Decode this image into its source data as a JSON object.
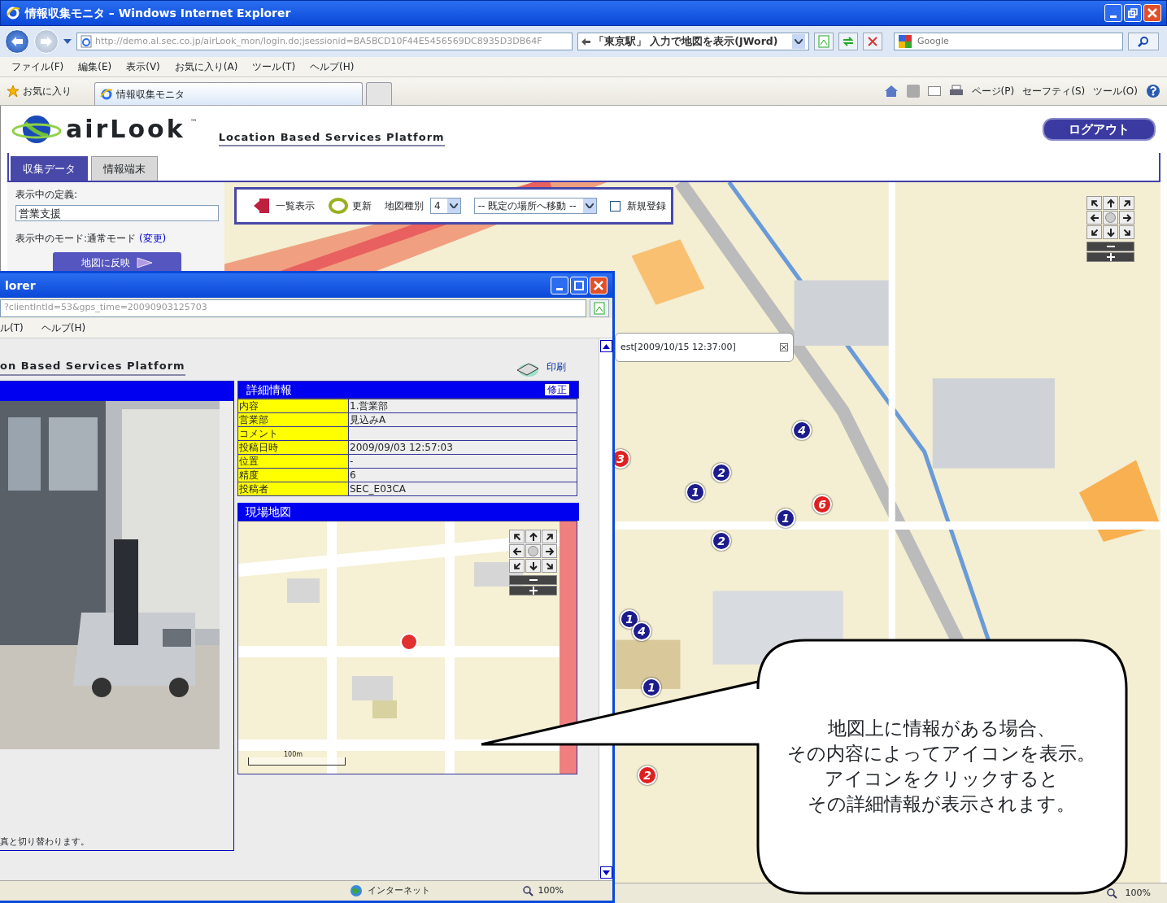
{
  "window": {
    "title": "情報収集モニタ – Windows Internet Explorer"
  },
  "address_bar": {
    "url": "http://demo.al.sec.co.jp/airLook_mon/login.do;jsessionid=BA5BCD10F44E5456569DC8935D3DB64F",
    "jword": "「東京駅」 入力で地図を表示(JWord)"
  },
  "search": {
    "placeholder": "Google"
  },
  "menu": [
    "ファイル(F)",
    "編集(E)",
    "表示(V)",
    "お気に入り(A)",
    "ツール(T)",
    "ヘルプ(H)"
  ],
  "favorites": "お気に入り",
  "tabs": [
    {
      "label": "情報収集モニタ",
      "selected": true
    }
  ],
  "command_bar": [
    "ページ(P)",
    "セーフティ(S)",
    "ツール(O)"
  ],
  "app": {
    "logo": "airLook",
    "trademark": "™",
    "tagline": "Location Based Services Platform",
    "logout": "ログアウト",
    "tabs": [
      {
        "label": "収集データ",
        "selected": true
      },
      {
        "label": "情報端末",
        "selected": false
      }
    ],
    "definition_label": "表示中の定義:",
    "definition_value": "営業支援",
    "mode_label": "表示中のモード:通常モード",
    "mode_link": "(変更)",
    "apply_button": "地図に反映",
    "toolbar": {
      "list": "一覧表示",
      "refresh": "更新",
      "map_type_label": "地図種別",
      "map_type": "4",
      "location": "-- 既定の場所へ移動 --",
      "new_label": "新規登録",
      "new_checked": false
    },
    "tooltip": "est[2009/10/15 12:37:00]",
    "markers": [
      {
        "label": "3",
        "color": "#e02020"
      },
      {
        "label": "4",
        "color": "#1c1c8c"
      },
      {
        "label": "2",
        "color": "#1c1c8c"
      },
      {
        "label": "1",
        "color": "#1c1c8c"
      },
      {
        "label": "6",
        "color": "#e02020"
      },
      {
        "label": "1",
        "color": "#1c1c8c"
      },
      {
        "label": "2",
        "color": "#1c1c8c"
      },
      {
        "label": "1",
        "color": "#1c1c8c"
      },
      {
        "label": "4",
        "color": "#1c1c8c"
      },
      {
        "label": "1",
        "color": "#1c1c8c"
      },
      {
        "label": "2",
        "color": "#e02020"
      }
    ]
  },
  "popup": {
    "title": "lorer",
    "url": "?clientIntId=53&gps_time=20090903125703",
    "menu": [
      "ル(T)",
      "ヘルプ(H)"
    ],
    "tagline": "on Based Services Platform",
    "print": "印刷",
    "details_title": "詳細情報",
    "edit": "修正",
    "details": [
      {
        "label": "内容",
        "value": "1.営業部"
      },
      {
        "label": "営業部",
        "value": "見込みA"
      },
      {
        "label": "コメント"
      },
      {
        "label": "投稿日時",
        "value": "2009/09/03 12:57:03"
      },
      {
        "label": "位置",
        "value": "-"
      },
      {
        "label": "精度",
        "value": "6"
      },
      {
        "label": "投稿者",
        "value": "SEC_E03CA"
      }
    ],
    "map_title": "現場地図",
    "scale": "100m",
    "note": "真と切り替わります。",
    "status": "インターネット",
    "zoom": "100%"
  },
  "status_bar": {
    "zoom": "100%"
  },
  "callout": {
    "lines": [
      "地図上に情報がある場合、",
      "その内容によってアイコンを表示。",
      "アイコンをクリックすると",
      "その詳細情報が表示されます。"
    ]
  }
}
